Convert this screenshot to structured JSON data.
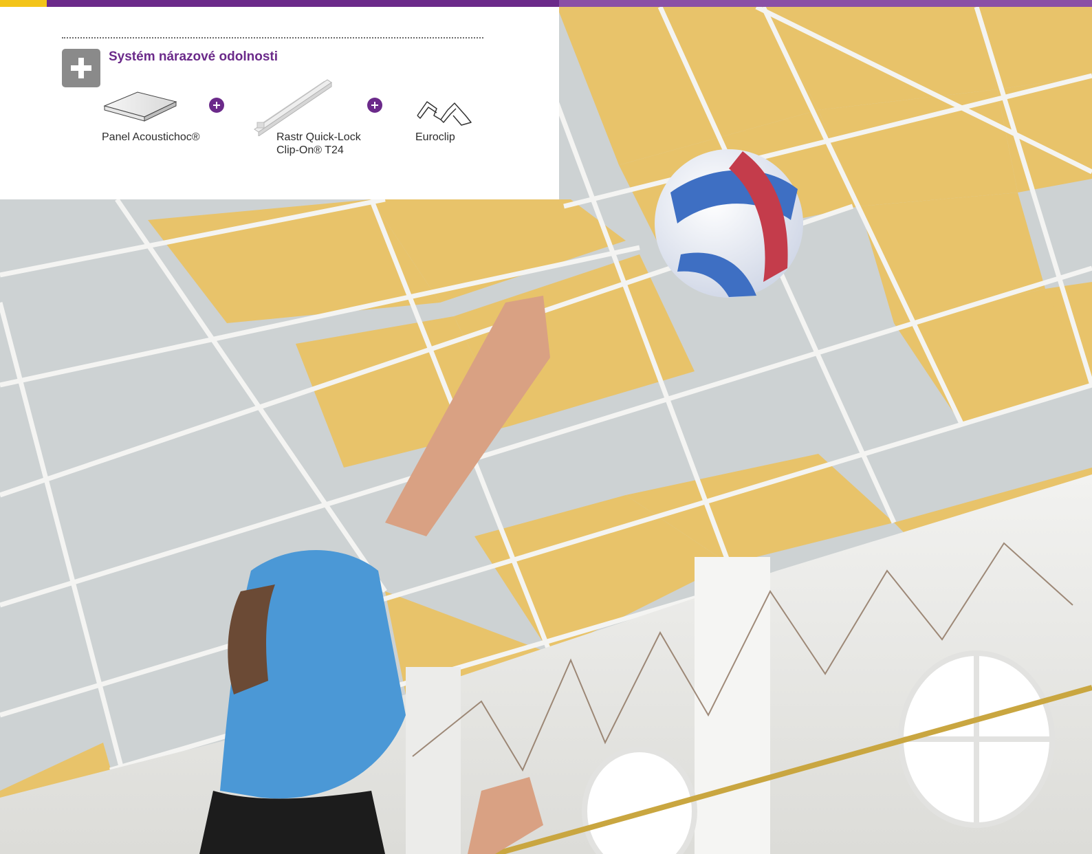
{
  "colors": {
    "accent_yellow": "#f3c419",
    "accent_purple": "#6b2a8a",
    "bar_purple_light": "#8a4fa6",
    "icon_gray": "#8a8a8a",
    "ceiling_yellow": "#e8c36a",
    "ceiling_gray": "#c9ced0"
  },
  "system": {
    "title": "Systém nárazové odolnosti",
    "icon": "plus-icon",
    "products": [
      {
        "label": "Panel Acoustichoc®",
        "icon": "ceiling-panel-icon"
      },
      {
        "label_line1": "Rastr Quick-Lock",
        "label_line2": "Clip-On® T24",
        "icon": "grid-rail-icon"
      },
      {
        "label": "Euroclip",
        "icon": "clip-icon"
      }
    ]
  },
  "photo": {
    "subject": "volleyball-player-icon"
  }
}
